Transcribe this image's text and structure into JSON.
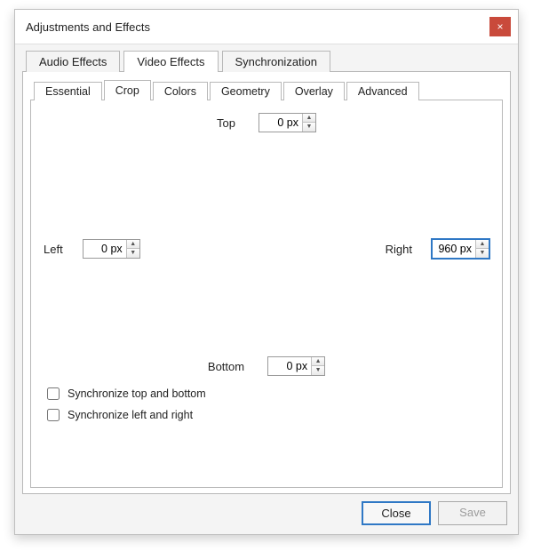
{
  "window": {
    "title": "Adjustments and Effects",
    "close_icon": "×"
  },
  "tabs_top": {
    "audio": "Audio Effects",
    "video": "Video Effects",
    "sync": "Synchronization"
  },
  "tabs_inner": {
    "essential": "Essential",
    "crop": "Crop",
    "colors": "Colors",
    "geometry": "Geometry",
    "overlay": "Overlay",
    "advanced": "Advanced"
  },
  "crop": {
    "top_label": "Top",
    "left_label": "Left",
    "right_label": "Right",
    "bottom_label": "Bottom",
    "top_value": "0 px",
    "left_value": "0 px",
    "right_value": "960 px",
    "bottom_value": "0 px",
    "sync_tb_label": "Synchronize top and bottom",
    "sync_lr_label": "Synchronize left and right",
    "sync_tb_checked": false,
    "sync_lr_checked": false
  },
  "footer": {
    "close": "Close",
    "save": "Save"
  }
}
